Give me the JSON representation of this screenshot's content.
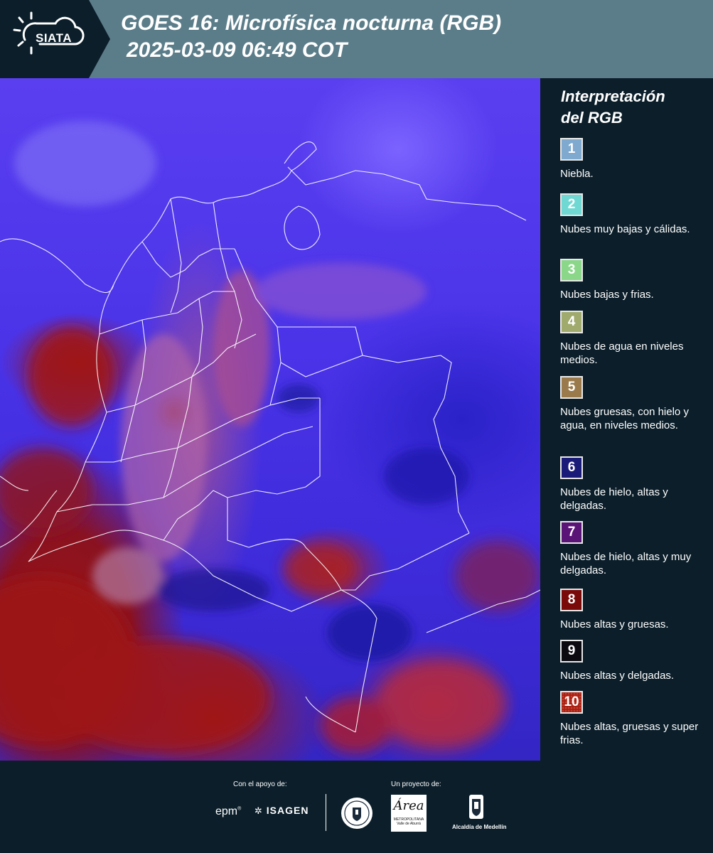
{
  "header": {
    "logo": "SIATA",
    "title_line1": "GOES 16: Microfísica nocturna (RGB)",
    "title_line2": "2025-03-09 06:49 COT"
  },
  "legend": {
    "title_line1": "Interpretación",
    "title_line2": "del RGB",
    "items": [
      {
        "number": "1",
        "label": "Niebla.",
        "color": "#7fa9cf"
      },
      {
        "number": "2",
        "label": "Nubes muy bajas y cálidas.",
        "color": "#6fd8d2"
      },
      {
        "number": "3",
        "label": "Nubes bajas y frias.",
        "color": "#8ad78a"
      },
      {
        "number": "4",
        "label": "Nubes de agua en niveles medios.",
        "color": "#9faa6c"
      },
      {
        "number": "5",
        "label": "Nubes gruesas, con hielo y agua, en niveles medios.",
        "color": "#9a7a4a"
      },
      {
        "number": "6",
        "label": "Nubes de hielo, altas y delgadas.",
        "color": "#1a1a78"
      },
      {
        "number": "7",
        "label": "Nubes de hielo, altas y muy delgadas.",
        "color": "#5a1478"
      },
      {
        "number": "8",
        "label": "Nubes altas y gruesas.",
        "color": "#7a0a0a"
      },
      {
        "number": "9",
        "label": "Nubes altas y delgadas.",
        "color": "#0a0a10"
      },
      {
        "number": "10",
        "label": "Nubes altas, gruesas y super frias.",
        "color": "#a82012"
      }
    ]
  },
  "footer": {
    "support_label": "Con el apoyo de:",
    "project_label": "Un proyecto de:",
    "epm": "epm",
    "isagen": "ISAGEN",
    "area_main": "Área",
    "area_sub1": "METROPOLITANA",
    "area_sub2": "Valle de Aburrá",
    "alcaldia": "Alcaldía de Medellín"
  }
}
